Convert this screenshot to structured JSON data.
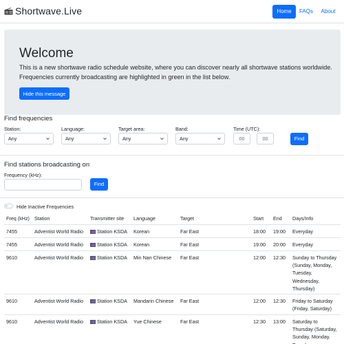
{
  "navbar": {
    "brand": "Shortwave.Live",
    "links": [
      {
        "label": "Home",
        "active": true
      },
      {
        "label": "FAQs",
        "active": false
      },
      {
        "label": "About",
        "active": false
      }
    ]
  },
  "welcome": {
    "title": "Welcome",
    "text": "This is a new shortwave radio schedule website, where you can discover nearly all shortwave stations worldwide. Frequencies currently broadcasting are highlighted in green in the list below.",
    "button": "Hide this message"
  },
  "find_frequencies": {
    "title": "Find frequencies",
    "station_label": "Station:",
    "station_value": "Any",
    "language_label": "Language:",
    "language_value": "Any",
    "target_label": "Target area:",
    "target_value": "Any",
    "band_label": "Band:",
    "band_value": "Any",
    "time_label": "Time (UTC):",
    "time_hour_placeholder": "00",
    "time_min_placeholder": "00",
    "find_button": "Find"
  },
  "find_stations": {
    "title": "Find stations broadcasting on",
    "freq_label": "Frequency (kHz):",
    "find_button": "Find"
  },
  "toggle": {
    "label": "Hide Inactive Frequencies",
    "on": false
  },
  "table": {
    "headers": {
      "freq": "Freq (kHz)",
      "station": "Station",
      "site": "Transmitter site",
      "language": "Language",
      "target": "Target",
      "start": "Start",
      "end": "End",
      "days": "Days/Info"
    },
    "rows": [
      {
        "freq": "7455",
        "station": "Adventist World Radio",
        "site": "Station KSDA",
        "language": "Korean",
        "target": "Far East",
        "start": "18:00",
        "end": "19:00",
        "days": [
          "Everyday"
        ]
      },
      {
        "freq": "7455",
        "station": "Adventist World Radio",
        "site": "Station KSDA",
        "language": "Korean",
        "target": "Far East",
        "start": "19:00",
        "end": "20:00",
        "days": [
          "Everyday"
        ]
      },
      {
        "freq": "9610",
        "station": "Adventist World Radio",
        "site": "Station KSDA",
        "language": "Min Nan Chinese",
        "target": "Far East",
        "start": "12:00",
        "end": "12:30",
        "days": [
          "Sunday to Thursday",
          "(Sunday, Monday,",
          "Tuesday,",
          "Wednesday,",
          "Thursday)"
        ]
      },
      {
        "freq": "9610",
        "station": "Adventist World Radio",
        "site": "Station KSDA",
        "language": "Mandarin Chinese",
        "target": "Far East",
        "start": "12:00",
        "end": "12:30",
        "days": [
          "Friday to Saturday",
          "(Friday, Saturday)"
        ]
      },
      {
        "freq": "9610",
        "station": "Adventist World Radio",
        "site": "Station KSDA",
        "language": "Yue Chinese",
        "target": "Far East",
        "start": "12:30",
        "end": "13:00",
        "days": [
          "Saturday to",
          "Thursday (Saturday,",
          "Sunday, Monday,",
          "Tuesday,"
        ]
      }
    ]
  }
}
